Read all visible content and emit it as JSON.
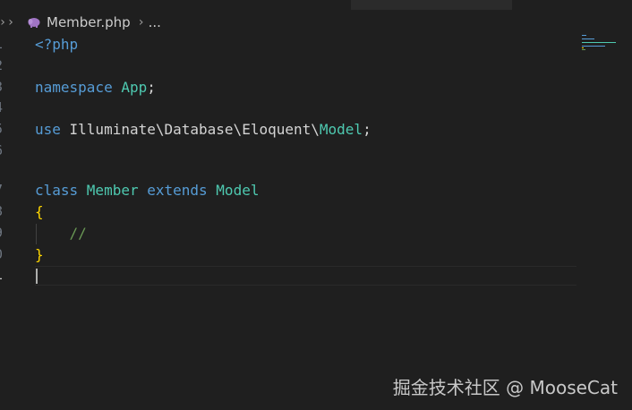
{
  "breadcrumb": {
    "file_name": "Member.php",
    "ellipsis": "...",
    "file_icon": "php-elephant-icon"
  },
  "editor": {
    "lines": [
      {
        "number": "1",
        "tokens": [
          {
            "t": "<?php",
            "c": "kw"
          }
        ]
      },
      {
        "number": "2",
        "tokens": []
      },
      {
        "number": "3",
        "tokens": [
          {
            "t": "namespace ",
            "c": "kw"
          },
          {
            "t": "App",
            "c": "cls"
          },
          {
            "t": ";",
            "c": "plain"
          }
        ]
      },
      {
        "number": "4",
        "tokens": []
      },
      {
        "number": "5",
        "tokens": [
          {
            "t": "use ",
            "c": "kw"
          },
          {
            "t": "Illuminate\\Database\\Eloquent\\",
            "c": "plain"
          },
          {
            "t": "Model",
            "c": "cls"
          },
          {
            "t": ";",
            "c": "plain"
          }
        ]
      },
      {
        "number": "6",
        "tokens": []
      },
      {
        "number": "7",
        "tokens": [
          {
            "t": "class ",
            "c": "kw"
          },
          {
            "t": "Member ",
            "c": "cls"
          },
          {
            "t": "extends ",
            "c": "kw"
          },
          {
            "t": "Model",
            "c": "cls"
          }
        ]
      },
      {
        "number": "8",
        "tokens": [
          {
            "t": "{",
            "c": "brace"
          }
        ]
      },
      {
        "number": "9",
        "tokens": [
          {
            "t": "    //",
            "c": "cmt"
          }
        ]
      },
      {
        "number": "0",
        "tokens": [
          {
            "t": "}",
            "c": "brace"
          }
        ]
      },
      {
        "number": "1",
        "tokens": [],
        "active": true
      }
    ]
  },
  "colors": {
    "background": "#1f1f1f",
    "keyword": "#569cd6",
    "class_name": "#4ec9b0",
    "bracket": "#ffd700",
    "comment": "#6a9955",
    "text": "#d4d4d4"
  },
  "watermark": "掘金技术社区 @ MooseCat"
}
